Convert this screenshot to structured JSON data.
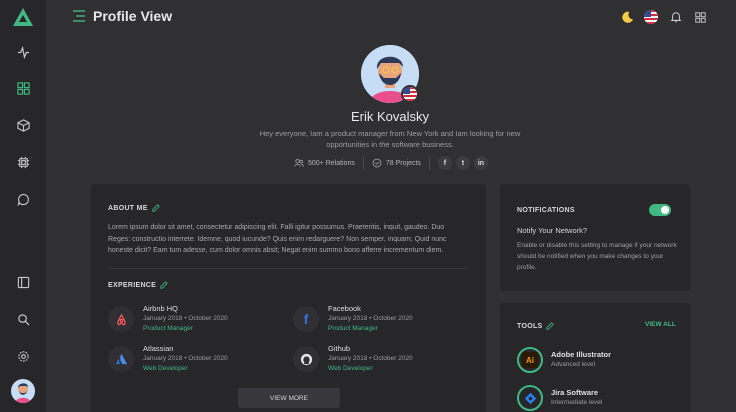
{
  "header": {
    "title": "Profile View"
  },
  "profile": {
    "name": "Erik Kovalsky",
    "bio": "Hey everyone,  Iam a product manager from New York and Iam looking for new opportunities in the software business.",
    "relations": "500+ Relations",
    "projects": "78 Projects",
    "socials": [
      "f",
      "t",
      "in"
    ]
  },
  "about": {
    "title": "ABOUT ME",
    "text": "Lorem ipsum dolor sit amet, consectetur adipiscing elit. Falli igitur possumus. Praeteritis, inquit, gaudeo. Duo Reges: constructio interrete. Idemne, quod iucunde? Quis enim redarguere? Non semper, inquam; Quid nunc honeste dicit? Eam tum adesse, cum dolor omnis absit; Negat enim summo bono afferre incrementum diem."
  },
  "experience": {
    "title": "EXPERIENCE",
    "items": [
      {
        "company": "Airbnb HQ",
        "start": "January 2018",
        "end": "October 2020",
        "role": "Product Manager",
        "logo": "airbnb-icon"
      },
      {
        "company": "Facebook",
        "start": "January 2018",
        "end": "October 2020",
        "role": "Product Manager",
        "logo": "facebook-icon"
      },
      {
        "company": "Atlassian",
        "start": "January 2018",
        "end": "October 2020",
        "role": "Web Developer",
        "logo": "atlassian-icon"
      },
      {
        "company": "Github",
        "start": "January 2018",
        "end": "October 2020",
        "role": "Web Developer",
        "logo": "github-icon"
      }
    ],
    "view_more": "VIEW MORE"
  },
  "notifications": {
    "title": "NOTIFICATIONS",
    "enabled": true,
    "subtitle": "Notify Your Network?",
    "text": "Enable or disable this setting to manage if your network should be notified when you make changes to your profile."
  },
  "tools": {
    "title": "TOOLS",
    "view_all": "VIEW ALL",
    "items": [
      {
        "name": "Adobe Illustrator",
        "level": "Advanced level",
        "icon": "illustrator-icon"
      },
      {
        "name": "Jira Software",
        "level": "Intermediate level",
        "icon": "jira-icon"
      }
    ]
  },
  "colors": {
    "accent": "#41b883",
    "sidebar": "#27272a",
    "background": "#303033",
    "card": "#27272a"
  }
}
